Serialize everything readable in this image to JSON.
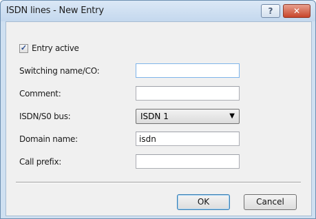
{
  "window": {
    "title": "ISDN lines - New Entry",
    "help_glyph": "?",
    "close_glyph": "✕"
  },
  "form": {
    "entry_active_label": "Entry active",
    "entry_active_checked": true,
    "switching_name_label": "Switching name/CO:",
    "switching_name_value": "",
    "comment_label": "Comment:",
    "comment_value": "",
    "isdn_bus_label": "ISDN/S0 bus:",
    "isdn_bus_value": "ISDN 1",
    "domain_name_label": "Domain name:",
    "domain_name_value": "isdn",
    "call_prefix_label": "Call prefix:",
    "call_prefix_value": ""
  },
  "buttons": {
    "ok": "OK",
    "cancel": "Cancel"
  }
}
